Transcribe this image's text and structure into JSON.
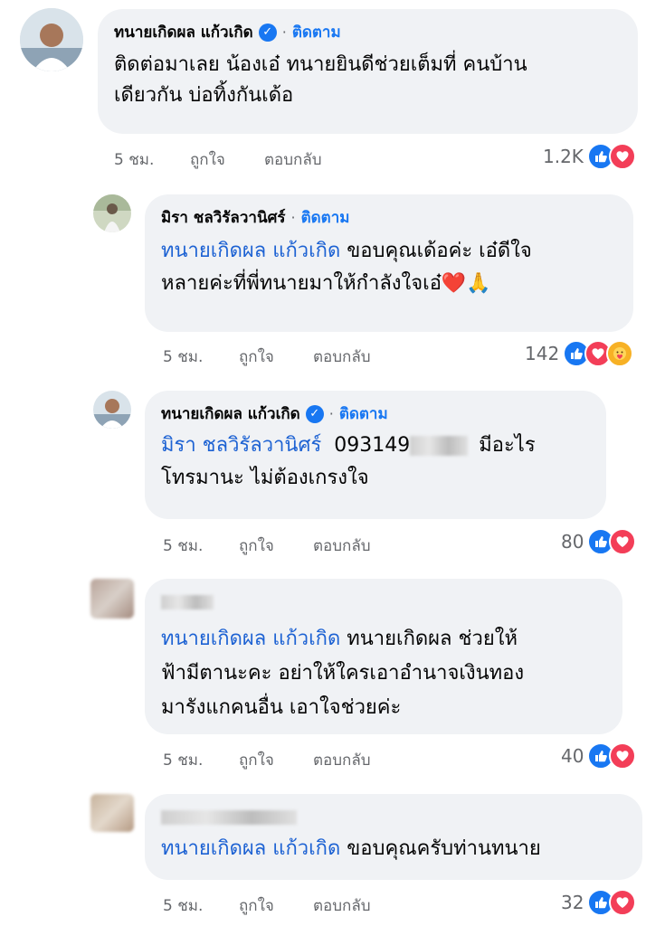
{
  "comments": [
    {
      "name": "ทนายเกิดผล แก้วเกิด",
      "follow": "ติดตาม",
      "dot": "·",
      "lines": [
        "ติดต่อมาเลย น้องเอ๋ ทนายยินดีช่วยเต็มที่ คนบ้าน",
        "เดียวกัน บ่อทิ้งกันเด้อ"
      ],
      "time": "5 ชม.",
      "like": "ถูกใจ",
      "reply": "ตอบกลับ",
      "count": "1.2K"
    },
    {
      "name": "มิรา ชลวิรัลวานิศร์",
      "follow": "ติดตาม",
      "dot": "·",
      "mention": "ทนายเกิดผล แก้วเกิด",
      "line1_rest": " ขอบคุณเด้อค่ะ เอ๋ดีใจ",
      "line2": "หลายค่ะที่พี่ทนายมาให้กำลังใจเอ๋❤️🙏",
      "time": "5 ชม.",
      "like": "ถูกใจ",
      "reply": "ตอบกลับ",
      "count": "142"
    },
    {
      "name": "ทนายเกิดผล แก้วเกิด",
      "follow": "ติดตาม",
      "dot": "·",
      "mention": "มิรา ชลวิรัลวานิศร์",
      "phone": "093149",
      "line1_rest": "มีอะไร",
      "line2": "โทรมานะ ไม่ต้องเกรงใจ",
      "time": "5 ชม.",
      "like": "ถูกใจ",
      "reply": "ตอบกลับ",
      "count": "80"
    },
    {
      "mention": "ทนายเกิดผล แก้วเกิด",
      "line1_rest": " ทนายเกิดผล ช่วยให้",
      "line2": "ฟ้ามีตานะคะ อย่าให้ใครเอาอำนาจเงินทอง",
      "line3": "มารังแกคนอื่น เอาใจช่วยค่ะ",
      "time": "5 ชม.",
      "like": "ถูกใจ",
      "reply": "ตอบกลับ",
      "count": "40"
    },
    {
      "mention": "ทนายเกิดผล แก้วเกิด",
      "line1_rest": " ขอบคุณครับท่านทนาย",
      "time": "5 ชม.",
      "like": "ถูกใจ",
      "reply": "ตอบกลับ",
      "count": "32"
    }
  ],
  "icons": {
    "verified": "✓",
    "like": "👍",
    "love": "❤",
    "care": "🤗"
  },
  "colors": {
    "accent": "#1877f2",
    "bubble": "#f0f2f5",
    "meta": "#65676b"
  }
}
